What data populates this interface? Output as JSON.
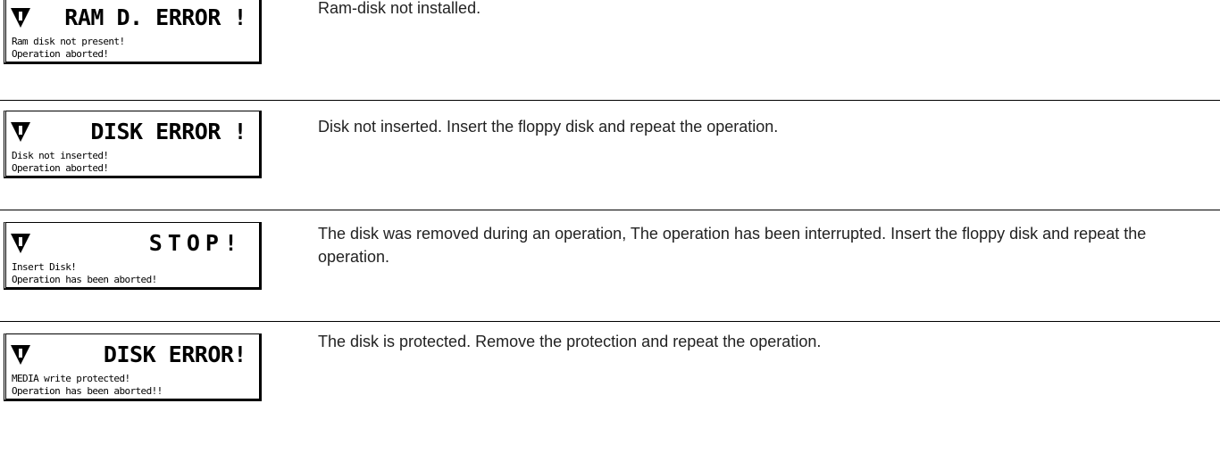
{
  "entries": [
    {
      "display": {
        "title": "RAM D. ERROR !",
        "line1": "Ram disk not present!",
        "line2": "Operation aborted!"
      },
      "description": "Ram-disk not installed."
    },
    {
      "display": {
        "title": "DISK ERROR !",
        "line1": "Disk not inserted!",
        "line2": "Operation aborted!"
      },
      "description": "Disk not inserted. Insert the floppy disk and repeat the operation."
    },
    {
      "display": {
        "title": "STOP!",
        "line1": "Insert Disk!",
        "line2": "Operation has been aborted!"
      },
      "description": "The disk was removed during an operation, The operation has been interrupted. Insert the floppy disk and repeat the operation."
    },
    {
      "display": {
        "title": "DISK ERROR!",
        "line1": "MEDIA write protected!",
        "line2": "Operation has been aborted!!"
      },
      "description": "The disk is protected. Remove the protection and repeat the operation."
    }
  ],
  "icons": {
    "warning": "warning-triangle-icon"
  }
}
